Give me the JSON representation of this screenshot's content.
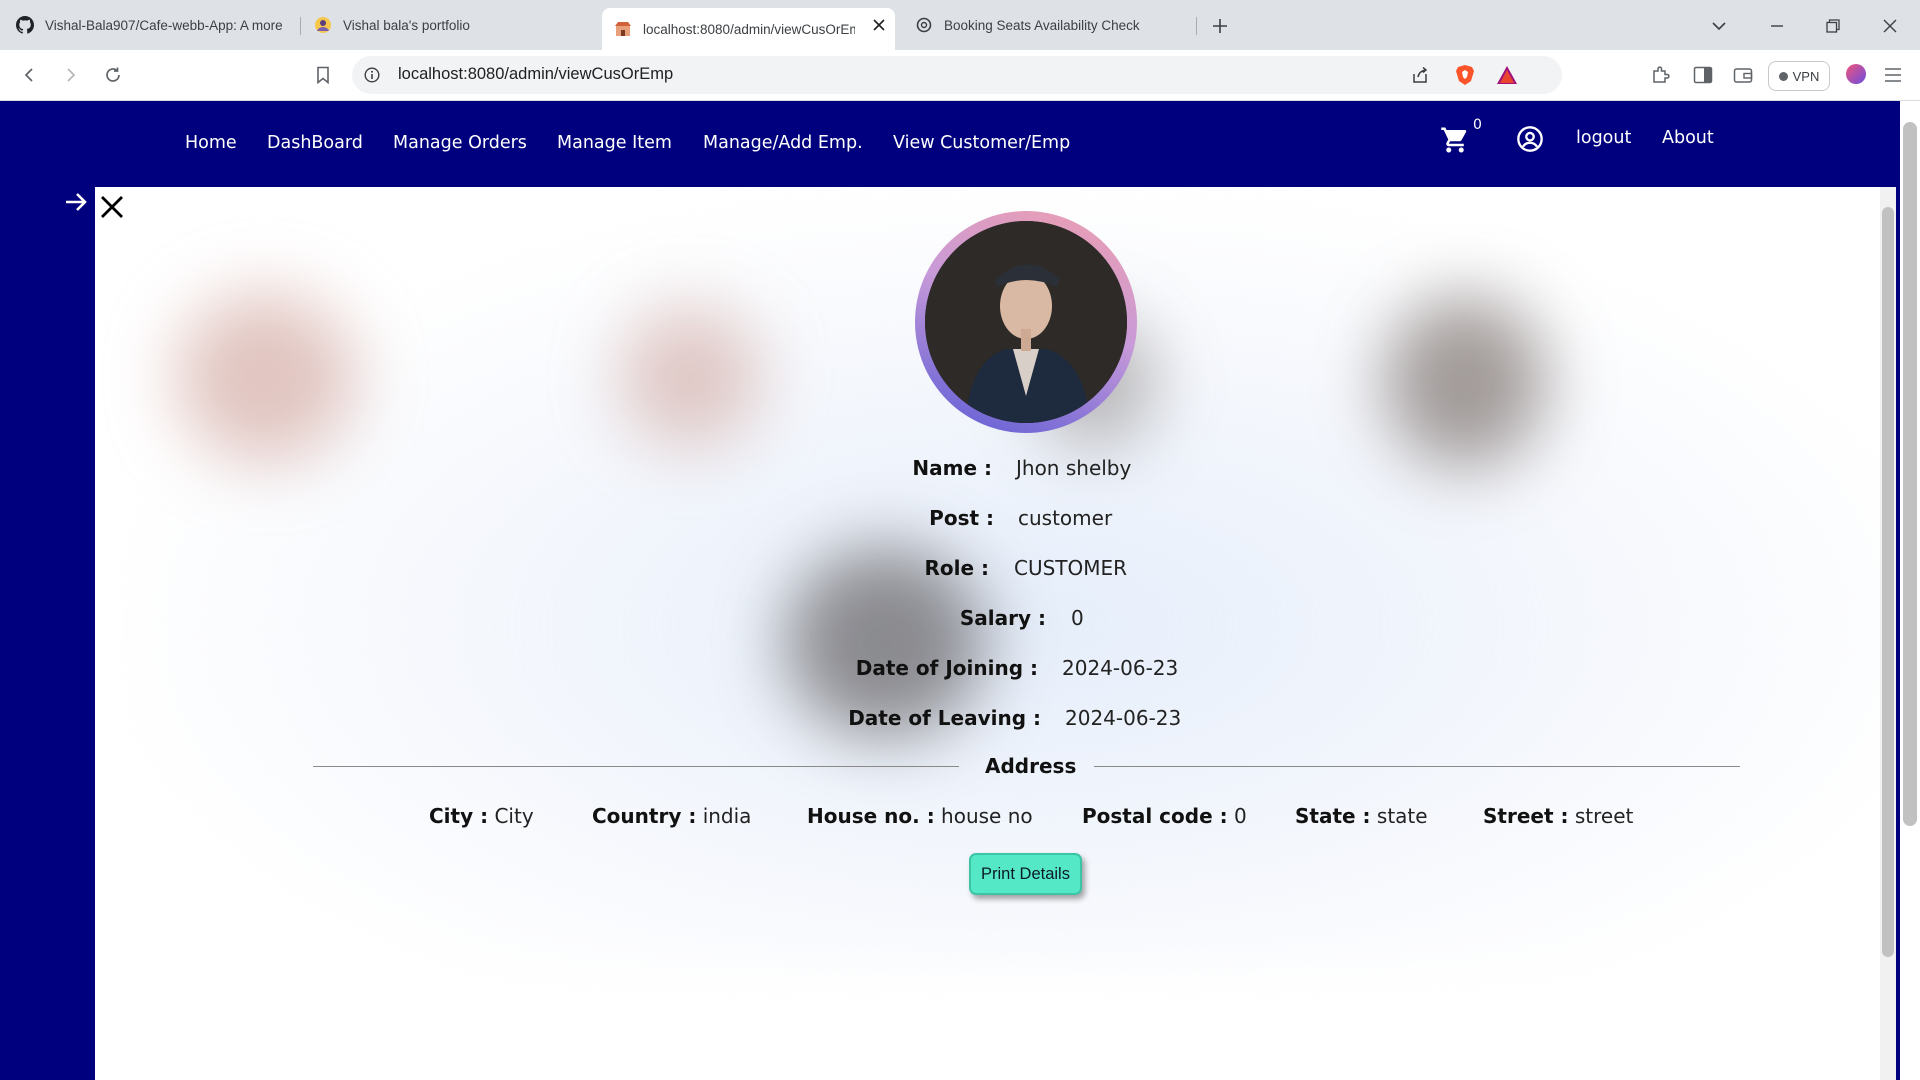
{
  "browser": {
    "tabs": [
      {
        "title": "Vishal-Bala907/Cafe-webb-App: A more",
        "icon": "github-icon",
        "active": false
      },
      {
        "title": "Vishal bala's portfolio",
        "icon": "portfolio-avatar-icon",
        "active": false
      },
      {
        "title": "localhost:8080/admin/viewCusOrEm",
        "icon": "cafe-favicon-icon",
        "active": true
      },
      {
        "title": "Booking Seats Availability Check",
        "icon": "openai-icon",
        "active": false
      }
    ],
    "url": "localhost:8080/admin/viewCusOrEmp",
    "vpn_label": "VPN"
  },
  "navbar": {
    "links": [
      "Home",
      "DashBoard",
      "Manage Orders",
      "Manage Item",
      "Manage/Add Emp.",
      "View Customer/Emp"
    ],
    "cart_count": "0",
    "logout": "logout",
    "about": "About"
  },
  "profile": {
    "fields": [
      {
        "label": "Name :",
        "value": "Jhon shelby"
      },
      {
        "label": "Post :",
        "value": "customer"
      },
      {
        "label": "Role :",
        "value": "CUSTOMER"
      },
      {
        "label": "Salary :",
        "value": "0"
      },
      {
        "label": "Date of Joining :",
        "value": "2024-06-23"
      },
      {
        "label": "Date of Leaving :",
        "value": "2024-06-23"
      }
    ],
    "address_title": "Address",
    "address": [
      {
        "label": "City :",
        "value": "City"
      },
      {
        "label": "Country :",
        "value": "india"
      },
      {
        "label": "House no. :",
        "value": "house no"
      },
      {
        "label": "Postal code :",
        "value": "0"
      },
      {
        "label": "State :",
        "value": "state"
      },
      {
        "label": "Street :",
        "value": "street"
      }
    ],
    "print_button": "Print Details"
  },
  "colors": {
    "navbar_bg": "#00007e",
    "button_bg": "#54e8c6"
  }
}
